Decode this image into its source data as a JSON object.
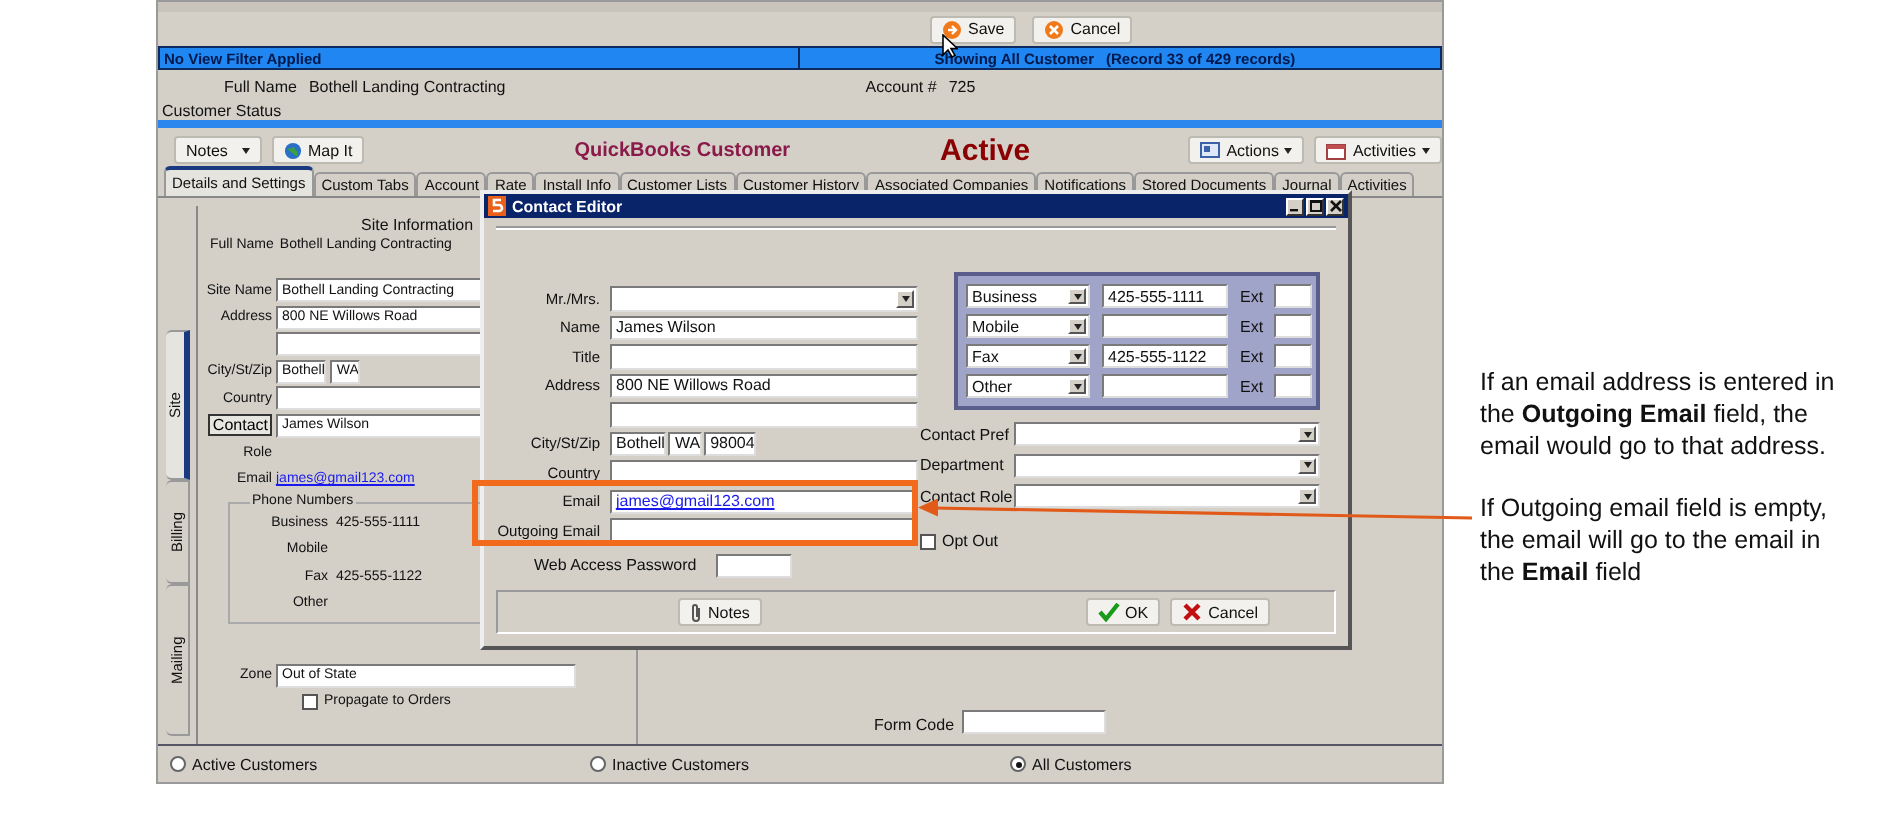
{
  "toolbar": {
    "buttons": [
      {
        "label": "Save",
        "kind": "save"
      },
      {
        "label": "Cancel",
        "kind": "cancel"
      }
    ]
  },
  "status_bar": {
    "filter": "No View Filter Applied",
    "showing": "Showing All Customer",
    "record": "(Record 33 of 429 records)"
  },
  "header": {
    "full_name_label": "Full Name",
    "full_name": "Bothell Landing Contracting",
    "account_label": "Account #",
    "account": "725",
    "status_label": "Customer Status"
  },
  "actions": {
    "notes": "Notes",
    "map": "Map It",
    "title": "QuickBooks Customer",
    "status": "Active",
    "actions": "Actions",
    "activities": "Activities"
  },
  "tabs": [
    {
      "label": "Details and Settings",
      "selected": true
    },
    {
      "label": "Custom Tabs",
      "selected": false
    },
    {
      "label": "Account",
      "selected": false
    },
    {
      "label": "Rate",
      "selected": false
    },
    {
      "label": "Install Info",
      "selected": false
    },
    {
      "label": "Customer Lists",
      "selected": false
    },
    {
      "label": "Customer History",
      "selected": false
    },
    {
      "label": "Associated Companies",
      "selected": false
    },
    {
      "label": "Notifications",
      "selected": false
    },
    {
      "label": "Stored Documents",
      "selected": false
    },
    {
      "label": "Journal",
      "selected": false
    },
    {
      "label": "Activities",
      "selected": false
    }
  ],
  "side_tabs": [
    {
      "label": "Site",
      "selected": true
    },
    {
      "label": "Billing",
      "selected": false
    },
    {
      "label": "Mailing",
      "selected": false
    }
  ],
  "site": {
    "heading": "Site Information",
    "full_name_label": "Full Name",
    "full_name": "Bothell Landing Contracting",
    "fields": [
      {
        "kind": "field",
        "label": "Site Name",
        "value": "Bothell Landing Contracting"
      },
      {
        "kind": "field",
        "label": "Address",
        "value": "800 NE Willows Road"
      },
      {
        "kind": "field"
      },
      {
        "kind": "city",
        "label": "City/St/Zip",
        "city": "Bothell",
        "state": "WA"
      },
      {
        "kind": "field",
        "label": "Country"
      },
      {
        "kind": "contact",
        "label": "Contact",
        "value": "James Wilson"
      },
      {
        "kind": "plain",
        "label": "Role"
      },
      {
        "kind": "link",
        "label": "Email",
        "value": "james@gmail123.com"
      }
    ],
    "phones": {
      "title": "Phone Numbers",
      "rows": [
        {
          "label": "Business",
          "value": "425-555-1111"
        },
        {
          "label": "Mobile"
        },
        {
          "label": "Fax",
          "value": "425-555-1122"
        },
        {
          "label": "Other"
        }
      ]
    },
    "zone": {
      "label": "Zone",
      "value": "Out of State"
    },
    "propagate": {
      "label": "Propagate to Orders",
      "checked": false
    }
  },
  "form_code": {
    "label": "Form Code"
  },
  "filters": [
    {
      "label": "Active Customers",
      "selected": false
    },
    {
      "label": "Inactive Customers",
      "selected": false
    },
    {
      "label": "All Customers",
      "selected": true
    }
  ],
  "dialog": {
    "title": "Contact Editor",
    "fields": [
      {
        "kind": "select",
        "label": "Mr./Mrs."
      },
      {
        "kind": "field",
        "label": "Name",
        "value": "James Wilson"
      },
      {
        "kind": "field",
        "label": "Title"
      },
      {
        "kind": "field",
        "label": "Address",
        "value": "800 NE Willows Road"
      },
      {
        "kind": "field"
      },
      {
        "kind": "city",
        "label": "City/St/Zip",
        "city": "Bothell",
        "state": "WA",
        "zip": "98004"
      },
      {
        "kind": "field",
        "label": "Country"
      },
      {
        "kind": "link",
        "label": "Email",
        "value": "james@gmail123.com"
      },
      {
        "kind": "field",
        "label": "Outgoing Email"
      },
      {
        "kind": "short",
        "label": "Web Access Password"
      }
    ],
    "phones": [
      {
        "type": "Business",
        "number": "425-555-1111",
        "ext_label": "Ext"
      },
      {
        "type": "Mobile",
        "ext_label": "Ext"
      },
      {
        "type": "Fax",
        "number": "425-555-1122",
        "ext_label": "Ext"
      },
      {
        "type": "Other",
        "ext_label": "Ext"
      }
    ],
    "selects": [
      {
        "label": "Contact Pref"
      },
      {
        "label": "Department"
      },
      {
        "label": "Contact Role"
      }
    ],
    "opt_out": {
      "label": "Opt Out",
      "checked": false
    },
    "buttons": [
      {
        "label": "Notes",
        "kind": "notes"
      },
      {
        "label": "OK",
        "kind": "ok"
      },
      {
        "label": "Cancel",
        "kind": "cancel"
      }
    ]
  },
  "annotation": {
    "paragraphs": [
      "If an email address is entered in the **Outgoing Email** field, the email would go to that address.",
      "If Outgoing email field is empty, the email will go to the email in the **Email** field"
    ]
  }
}
